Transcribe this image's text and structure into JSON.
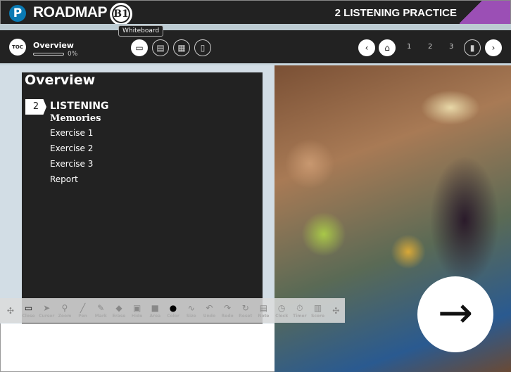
{
  "header": {
    "brand": "ROADMAP",
    "level": "B1",
    "title": "2 LISTENING PRACTICE",
    "accent": "#9b4fb5"
  },
  "nav": {
    "toc": "TOC",
    "section": "Overview",
    "progress_percent": 0,
    "progress_label": "0%",
    "tooltip": "Whiteboard",
    "pages": [
      "1",
      "2",
      "3"
    ]
  },
  "board": {
    "title": "Overview",
    "unit_number": "2",
    "section": "LISTENING",
    "subtitle": "Memories",
    "items": [
      "Exercise 1",
      "Exercise 2",
      "Exercise 3",
      "Report"
    ]
  },
  "toolbar": [
    {
      "label": "Close",
      "icon": "whiteboard-icon",
      "g": "▭"
    },
    {
      "label": "Cursor",
      "icon": "cursor-icon",
      "g": "➤"
    },
    {
      "label": "Zoom",
      "icon": "zoom-icon",
      "g": "⚲"
    },
    {
      "label": "Pen",
      "icon": "pen-icon",
      "g": "╱"
    },
    {
      "label": "Mark",
      "icon": "marker-icon",
      "g": "✎"
    },
    {
      "label": "Erase",
      "icon": "eraser-icon",
      "g": "◆"
    },
    {
      "label": "Hide",
      "icon": "hide-icon",
      "g": "▣"
    },
    {
      "label": "Area",
      "icon": "area-icon",
      "g": "■"
    },
    {
      "label": "Color",
      "icon": "color-icon",
      "g": "●"
    },
    {
      "label": "Size",
      "icon": "size-icon",
      "g": "∿"
    },
    {
      "label": "Undo",
      "icon": "undo-icon",
      "g": "↶"
    },
    {
      "label": "Redo",
      "icon": "redo-icon",
      "g": "↷"
    },
    {
      "label": "Reset",
      "icon": "reset-icon",
      "g": "↻"
    },
    {
      "label": "Note",
      "icon": "note-icon",
      "g": "▤"
    },
    {
      "label": "Clock",
      "icon": "clock-icon",
      "g": "◷"
    },
    {
      "label": "Timer",
      "icon": "timer-icon",
      "g": "⏱"
    },
    {
      "label": "Score",
      "icon": "score-icon",
      "g": "▥"
    }
  ]
}
